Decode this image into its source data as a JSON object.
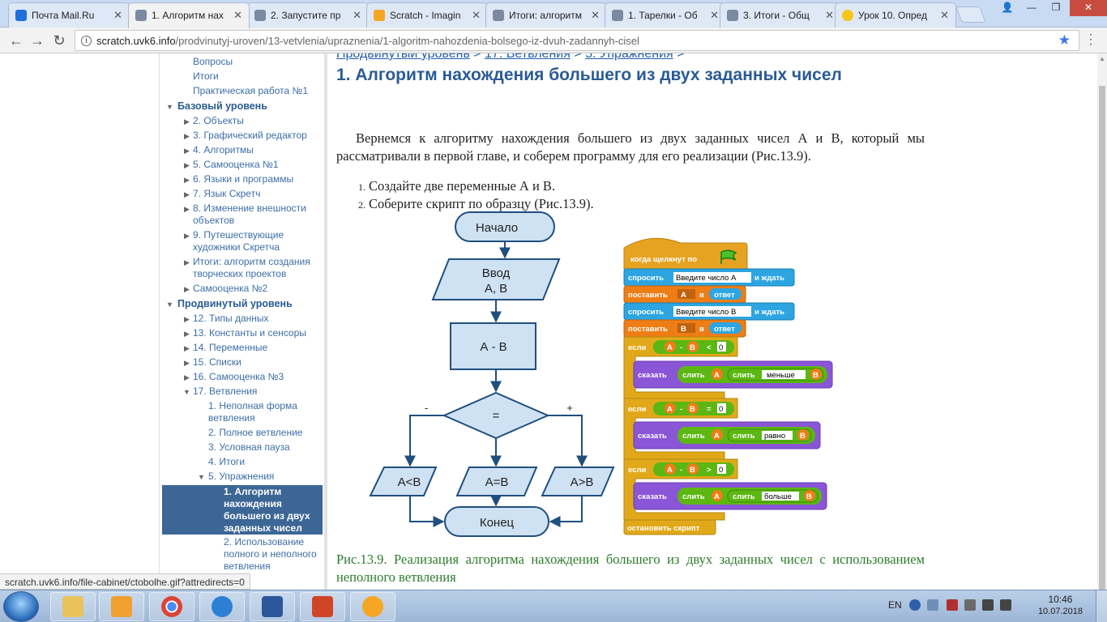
{
  "browser": {
    "tabs": [
      {
        "title": "Почта Mail.Ru",
        "color": "#1e6fd9",
        "active": false
      },
      {
        "title": "1. Алгоритм нах",
        "color": "#666666",
        "active": true
      },
      {
        "title": "2. Запустите пр",
        "color": "#666666",
        "active": false
      },
      {
        "title": "Scratch - Imagin",
        "color": "#f5a623",
        "active": false
      },
      {
        "title": "Итоги: алгоритм",
        "color": "#666666",
        "active": false
      },
      {
        "title": "1. Тарелки - Об",
        "color": "#666666",
        "active": false
      },
      {
        "title": "3. Итоги - Общ",
        "color": "#666666",
        "active": false
      },
      {
        "title": "Урок 10. Опред",
        "color": "#f5c518",
        "active": false
      }
    ],
    "url_host": "scratch.uvk6.info",
    "url_path": "/prodvinutyj-uroven/13-vetvlenia/upraznenia/1-algoritm-nahozdenia-bolsego-iz-dvuh-zadannyh-cisel",
    "status_url": "scratch.uvk6.info/file-cabinet/ctobolhe.gif?attredirects=0"
  },
  "sidebar": {
    "items": [
      {
        "label": "Вопросы"
      },
      {
        "label": "Итоги"
      },
      {
        "label": "Практическая работа №1"
      },
      {
        "label": "Базовый уровень"
      },
      {
        "label": "2. Объекты"
      },
      {
        "label": "3. Графический редактор"
      },
      {
        "label": "4. Алгоритмы"
      },
      {
        "label": "5. Самооценка №1"
      },
      {
        "label": "6. Языки и программы"
      },
      {
        "label": "7. Язык Скретч"
      },
      {
        "label": "8. Изменение внешности объектов"
      },
      {
        "label": "9. Путешествующие художники Скретча"
      },
      {
        "label": "Итоги: алгоритм создания творческих проектов"
      },
      {
        "label": "Самооценка №2"
      },
      {
        "label": "Продвинутый уровень"
      },
      {
        "label": "12. Типы данных"
      },
      {
        "label": "13. Константы и сенсоры"
      },
      {
        "label": "14. Переменные"
      },
      {
        "label": "15. Списки"
      },
      {
        "label": "16. Самооценка №3"
      },
      {
        "label": "17. Ветвления"
      },
      {
        "label": "1. Неполная форма ветвления"
      },
      {
        "label": "2. Полное ветвление"
      },
      {
        "label": "3. Условная пауза"
      },
      {
        "label": "4. Итоги"
      },
      {
        "label": "5. Упражнения"
      },
      {
        "label": "1. Алгоритм нахождения большего из двух заданных чисел"
      },
      {
        "label": "2. Использование полного и неполного ветвления"
      }
    ]
  },
  "content": {
    "breadcrumb": [
      "Продвинутый уровень",
      "17. Ветвления",
      "5. Упражнения"
    ],
    "breadcrumb_sep": ">",
    "title": "1. Алгоритм нахождения большего из двух заданных чисел",
    "paragraph": "Вернемся к алгоритму нахождения большего из двух заданных чисел А и В, который мы рассматривали в первой главе, и соберем программу для его реализации (Рис.13.9).",
    "list": [
      {
        "num": "1.",
        "text": "Создайте две переменные А и В."
      },
      {
        "num": "2.",
        "text": "Соберите скрипт по образцу (Рис.13.9)."
      }
    ],
    "caption": "Рис.13.9. Реализация алгоритма нахождения большего из двух заданных чисел с использованием неполного ветвления"
  },
  "flowchart": {
    "start": "Начало",
    "input_line1": "Ввод",
    "input_line2": "А, В",
    "process": "А - В",
    "decision": "=",
    "minus": "-",
    "plus": "+",
    "out_less": "А<В",
    "out_equal": "А=В",
    "out_greater": "А>В",
    "end": "Конец"
  },
  "scratch": {
    "hat": "когда щелкнут по",
    "ask": "спросить",
    "ask_a_text": "Введите число А",
    "ask_b_text": "Введите число В",
    "and_wait": "и ждать",
    "set": "поставить",
    "var_a": "А",
    "var_b": "В",
    "to": "в",
    "answer": "ответ",
    "if": "если",
    "minus": "-",
    "lt": "<",
    "eq": "=",
    "gt": ">",
    "zero": "0",
    "say": "сказать",
    "join": "слить",
    "less_word": "меньше",
    "equal_word": "равно",
    "greater_word": "больше",
    "stop": "остановить скрипт",
    "colors": {
      "events": "#e6a321",
      "sensing": "#2ca5e2",
      "variables": "#ee7d16",
      "control": "#e1a91a",
      "operators": "#5cb712",
      "looks": "#8a55d7"
    }
  },
  "taskbar": {
    "lang": "EN",
    "time": "10:46",
    "date": "10.07.2018"
  }
}
